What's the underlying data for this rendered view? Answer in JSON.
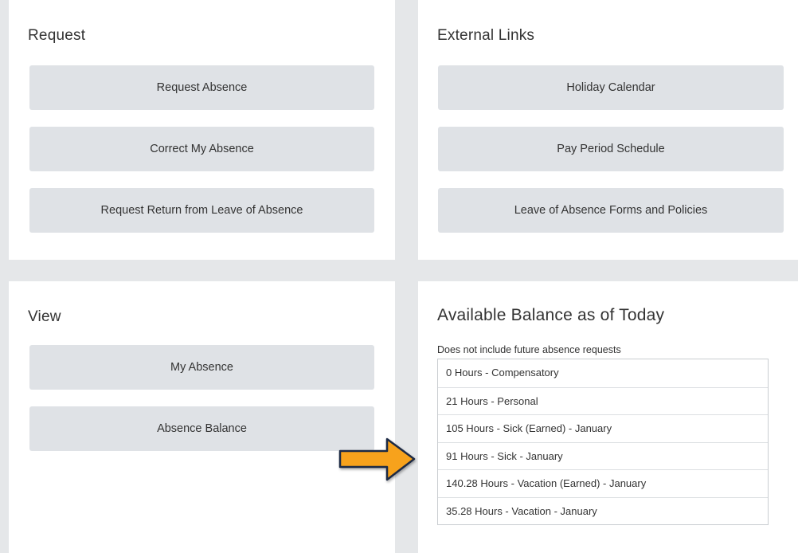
{
  "request": {
    "title": "Request",
    "buttons": [
      "Request Absence",
      "Correct My Absence",
      "Request Return from Leave of Absence"
    ]
  },
  "external_links": {
    "title": "External Links",
    "buttons": [
      "Holiday Calendar",
      "Pay Period Schedule",
      "Leave of Absence Forms and Policies"
    ]
  },
  "view": {
    "title": "View",
    "buttons": [
      "My Absence",
      "Absence Balance"
    ]
  },
  "balance": {
    "title": "Available Balance as of Today",
    "note": "Does not include future absence requests",
    "rows": [
      "0 Hours - Compensatory",
      "21 Hours - Personal",
      "105 Hours - Sick (Earned) - January",
      "91 Hours - Sick - January",
      "140.28 Hours - Vacation (Earned) - January",
      "35.28 Hours - Vacation - January"
    ]
  },
  "colors": {
    "background": "#e5e7e9",
    "button": "#dfe2e6",
    "arrow_fill": "#f7a21b",
    "arrow_stroke": "#1f2a44"
  },
  "icons": {
    "pointer": "arrow-right-icon"
  }
}
